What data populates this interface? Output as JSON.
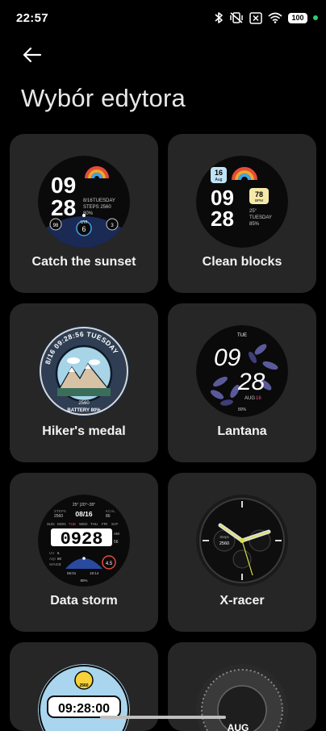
{
  "status_bar": {
    "time": "22:57",
    "battery": "100",
    "icons": [
      "bluetooth-icon",
      "vibrate-off-icon",
      "no-sim-icon",
      "wifi-icon",
      "battery-icon"
    ]
  },
  "header": {
    "back_icon": "arrow-left-icon",
    "title": "Wybór edytora"
  },
  "watch_faces": [
    {
      "name": "Catch the sunset",
      "hour": "09",
      "minute": "28",
      "date": "8/16",
      "day": "TUESDAY",
      "steps": "STEPS 2560",
      "battery": "80%",
      "uv_label": "UVI",
      "uv_value": "6",
      "left_value": "98",
      "right_value": "3"
    },
    {
      "name": "Clean blocks",
      "date_day": "16",
      "date_month": "Aug",
      "hour": "09",
      "minute": "28",
      "bpm_value": "78",
      "bpm_label": "BPM",
      "temp": "25°",
      "day": "TUESDAY",
      "battery": "85%"
    },
    {
      "name": "Hiker's medal",
      "ring_text": "8/16 09:28:56 TUESDAY",
      "steps": "2560",
      "battery": "BATTERY 80%"
    },
    {
      "name": "Lantana",
      "day": "TUE",
      "hour": "09",
      "minute": "28",
      "month": "AUG",
      "date": "16",
      "battery": "80%"
    },
    {
      "name": "Data storm",
      "temps": "25°  |20°~28°",
      "date": "08/16",
      "steps_label": "STEPS",
      "steps": "2560",
      "kcal_label": "KCAL",
      "kcal": "86",
      "weekdays": [
        "SUN",
        "MON",
        "TUE",
        "WED",
        "THU",
        "FRI",
        "SAT"
      ],
      "time": "0928",
      "ampm": "AM",
      "seconds": "56",
      "uv_label": "UV",
      "uv": "6",
      "aqi_label": "AQI",
      "aqi": "80",
      "wind_label": "WIND",
      "wind": "2",
      "sunrise": "06:01",
      "sunset": "19:14",
      "value": "4.5",
      "battery": "80%"
    },
    {
      "name": "X-racer",
      "steps_label": "Steps",
      "steps": "2560"
    },
    {
      "name": "",
      "badge": "2560",
      "time": "09:28:00"
    },
    {
      "name": "",
      "month": "AUG"
    }
  ],
  "colors": {
    "background": "#000000",
    "card": "#262626",
    "text": "#f2f2f2",
    "accent_green": "#2ecc71"
  }
}
